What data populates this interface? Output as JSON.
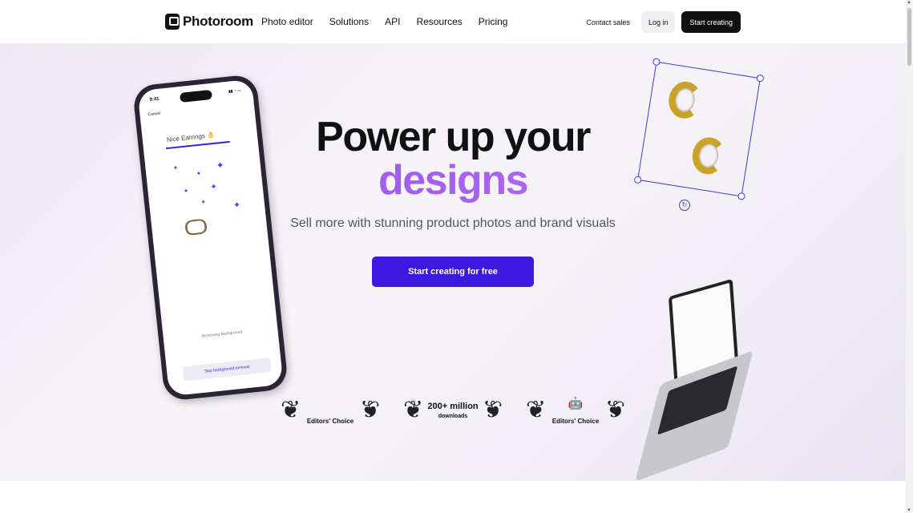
{
  "nav": {
    "brand": "Photoroom",
    "links": [
      "Photo editor",
      "Solutions",
      "API",
      "Resources",
      "Pricing"
    ],
    "contact": "Contact sales",
    "login": "Log in",
    "start": "Start creating"
  },
  "hero": {
    "headline_line1": "Power up your",
    "headline_line2": "designs",
    "subtitle": "Sell more with stunning product photos and brand visuals",
    "cta": "Start creating for free"
  },
  "phone": {
    "time": "9:41",
    "status": "▮▮ ◔ ▭",
    "cancel": "Cancel",
    "title": "Nice Earrings 👌",
    "removing": "Removing Background",
    "skip": "Skip background removal"
  },
  "awards": [
    {
      "type": "icon",
      "icon": "apple-icon",
      "glyph": "",
      "label": "Editors' Choice"
    },
    {
      "type": "text",
      "big": "200+ million",
      "small": "downloads"
    },
    {
      "type": "icon",
      "icon": "android-icon",
      "glyph": "🤖",
      "label": "Editors' Choice"
    }
  ],
  "colors": {
    "accent": "#3d1ae0",
    "gradient_start": "#8b46ee",
    "gradient_end": "#c07bf2"
  }
}
